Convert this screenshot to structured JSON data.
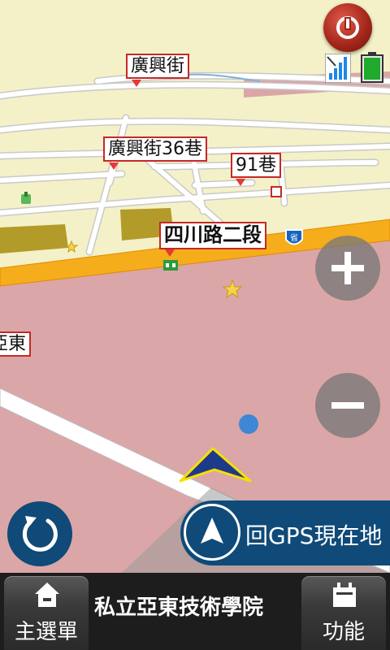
{
  "map": {
    "road_labels": [
      {
        "id": "guangxing-st",
        "text": "廣興街"
      },
      {
        "id": "guangxing-lane36",
        "text": "廣興街36巷"
      },
      {
        "id": "lane91",
        "text": "91巷"
      },
      {
        "id": "sichuan-rd",
        "text": "四川路二段"
      },
      {
        "id": "partial-east",
        "text": "亞東"
      }
    ],
    "highway_shield_text": "省",
    "colors": {
      "land": "#f4f1c8",
      "campus_zone": "#dba6a7",
      "main_road": "#f5ad1c",
      "vehicle_arrow": "#1e3a8a",
      "vehicle_outline": "#f5e000",
      "button_blue": "#0f4a78",
      "zoom_button_gray": "#787878",
      "power_red": "#a02418"
    }
  },
  "status": {
    "signal_icon": "signal-bars-icon",
    "battery_icon": "battery-full-icon"
  },
  "buttons": {
    "gps_return_label": "回GPS現在地"
  },
  "bottom_bar": {
    "main_menu_label": "主選單",
    "location_name": "私立亞東技術學院",
    "function_label": "功能"
  }
}
